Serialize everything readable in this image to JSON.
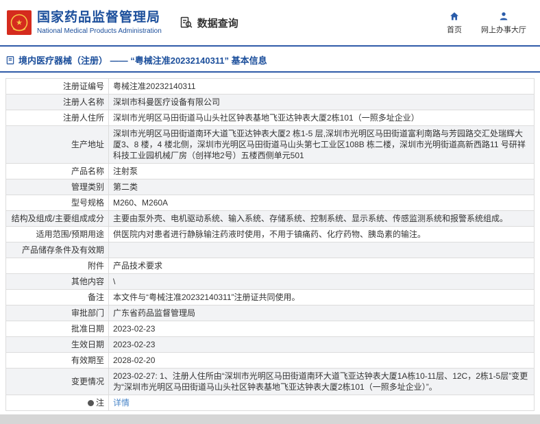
{
  "header": {
    "org_cn": "国家药品监督管理局",
    "org_en": "National Medical Products Administration",
    "nav_title": "数据查询",
    "home_label": "首页",
    "hall_label": "网上办事大厅"
  },
  "section": {
    "title": "境内医疗器械（注册） —— “粤械注准20232140311” 基本信息"
  },
  "colors": {
    "brand_blue": "#1b4e9b",
    "divider_blue": "#2e5aa8",
    "link_blue": "#4a86c8",
    "emblem_red": "#d52b1e"
  },
  "table": {
    "rows": [
      {
        "label": "注册证编号",
        "value": "粤械注准20232140311"
      },
      {
        "label": "注册人名称",
        "value": "深圳市科曼医疗设备有限公司"
      },
      {
        "label": "注册人住所",
        "value": "深圳市光明区马田街道马山头社区钟表基地飞亚达钟表大厦2栋101（一照多址企业）"
      },
      {
        "label": "生产地址",
        "value": "深圳市光明区马田街道南环大道飞亚达钟表大厦2 栋1-5 层,深圳市光明区马田街道富利南路与芳园路交汇处瑞辉大厦3、8 楼，4 楼北侧，深圳市光明区马田街道马山头第七工业区108B 栋二楼，深圳市光明街道高新西路11 号研祥科技工业园机械厂房（创祥地2号）五楼西侧单元501"
      },
      {
        "label": "产品名称",
        "value": "注射泵"
      },
      {
        "label": "管理类别",
        "value": "第二类"
      },
      {
        "label": "型号规格",
        "value": "M260、M260A"
      },
      {
        "label": "结构及组成/主要组成成分",
        "value": "主要由泵外壳、电机驱动系统、输入系统、存储系统、控制系统、显示系统、传感监测系统和报警系统组成。"
      },
      {
        "label": "适用范围/预期用途",
        "value": "供医院内对患者进行静脉输注药液时使用，不用于镇痛药、化疗药物、胰岛素的输注。"
      },
      {
        "label": "产品储存条件及有效期",
        "value": ""
      },
      {
        "label": "附件",
        "value": "产品技术要求"
      },
      {
        "label": "其他内容",
        "value": "\\"
      },
      {
        "label": "备注",
        "value": "本文件与“粤械注准20232140311”注册证共同使用。"
      },
      {
        "label": "审批部门",
        "value": "广东省药品监督管理局"
      },
      {
        "label": "批准日期",
        "value": "2023-02-23"
      },
      {
        "label": "生效日期",
        "value": "2023-02-23"
      },
      {
        "label": "有效期至",
        "value": "2028-02-20"
      },
      {
        "label": "变更情况",
        "value": "2023-02-27: 1、注册人住所由“深圳市光明区马田街道南环大道飞亚达钟表大厦1A栋10-11层、12C，2栋1-5层”变更为“深圳市光明区马田街道马山头社区钟表基地飞亚达钟表大厦2栋101（一照多址企业）”。"
      },
      {
        "label": "注",
        "value": "详情",
        "type": "link",
        "icon": "note-dot"
      }
    ]
  }
}
